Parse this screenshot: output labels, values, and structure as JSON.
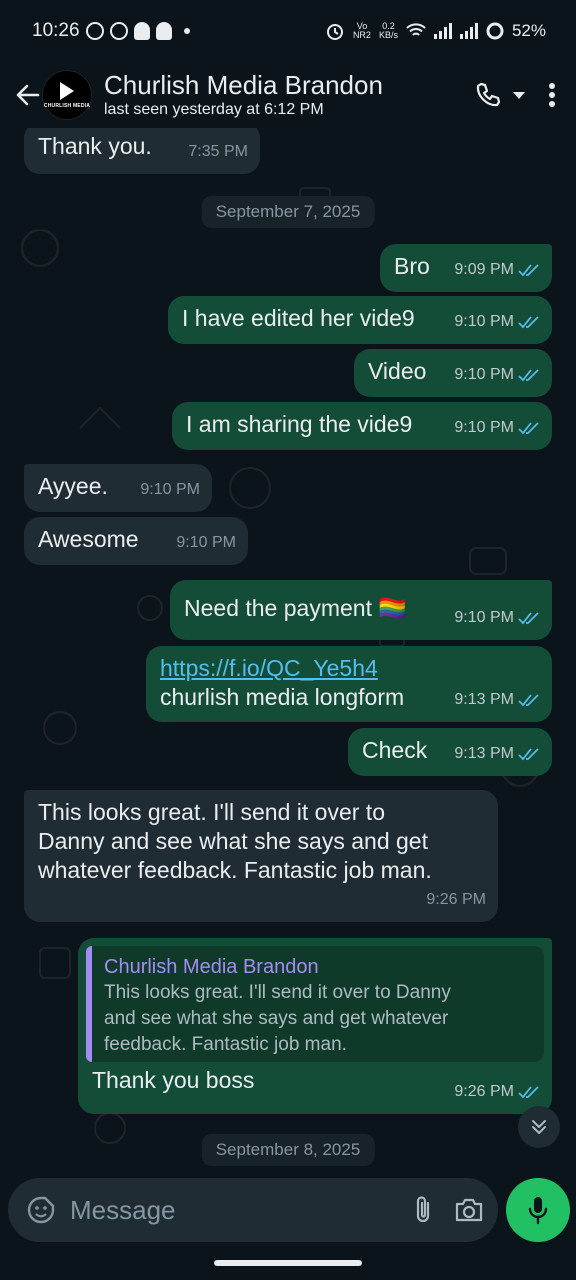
{
  "status_bar": {
    "time": "10:26",
    "battery": "52%",
    "net_speed_top": "0.2",
    "net_speed_bottom": "KB/s",
    "vo_top": "Vo",
    "vo_bottom": "NR2"
  },
  "header": {
    "contact_name": "Churlish Media Brandon",
    "last_seen": "last seen yesterday at 6:12 PM",
    "avatar_text": "CHURLISH MEDIA"
  },
  "messages": [
    {
      "id": "m1",
      "dir": "in",
      "text": "Thank you.",
      "time": "7:35 PM"
    },
    {
      "id": "d1",
      "type": "date",
      "text": "September 7, 2025"
    },
    {
      "id": "m2",
      "dir": "out",
      "text": "Bro",
      "time": "9:09 PM"
    },
    {
      "id": "m3",
      "dir": "out",
      "text": "I have edited her vide9",
      "time": "9:10 PM"
    },
    {
      "id": "m4",
      "dir": "out",
      "text": "Video",
      "time": "9:10 PM"
    },
    {
      "id": "m5",
      "dir": "out",
      "text": "I am sharing the vide9",
      "time": "9:10 PM"
    },
    {
      "id": "m6",
      "dir": "in",
      "text": "Ayyee.",
      "time": "9:10 PM"
    },
    {
      "id": "m7",
      "dir": "in",
      "text": "Awesome",
      "time": "9:10 PM"
    },
    {
      "id": "m8",
      "dir": "out",
      "text": "Need the payment 🏳️‍🌈",
      "time": "9:10 PM"
    },
    {
      "id": "m9",
      "dir": "out",
      "link": "https://f.io/QC_Ye5h4",
      "text": "churlish media longform",
      "time": "9:13 PM"
    },
    {
      "id": "m10",
      "dir": "out",
      "text": "Check",
      "time": "9:13 PM"
    },
    {
      "id": "m11",
      "dir": "in",
      "lines": [
        "This looks great. I'll send it over to",
        "Danny and see what she says and get",
        "whatever feedback. Fantastic job man."
      ],
      "time": "9:26 PM"
    },
    {
      "id": "m12",
      "dir": "out",
      "quote_name": "Churlish Media Brandon",
      "quote_lines": [
        "This looks great. I'll send it over to Danny",
        "and see what she says and get whatever",
        "feedback. Fantastic job man."
      ],
      "text": "Thank you boss",
      "time": "9:26 PM"
    },
    {
      "id": "d2",
      "type": "date",
      "text": "September 8, 2025"
    }
  ],
  "input": {
    "placeholder": "Message"
  },
  "colors": {
    "bg": "#0b141a",
    "incoming": "#202c33",
    "outgoing": "#144d37",
    "read_ticks": "#53bdeb",
    "mic": "#21c063",
    "quote_accent": "#a38cf4"
  },
  "icons": [
    "back-arrow-icon",
    "phone-icon",
    "dropdown-caret-icon",
    "more-vert-icon",
    "emoji-sticker-icon",
    "attach-icon",
    "camera-icon",
    "mic-icon",
    "scroll-down-icon",
    "double-check-icon"
  ]
}
